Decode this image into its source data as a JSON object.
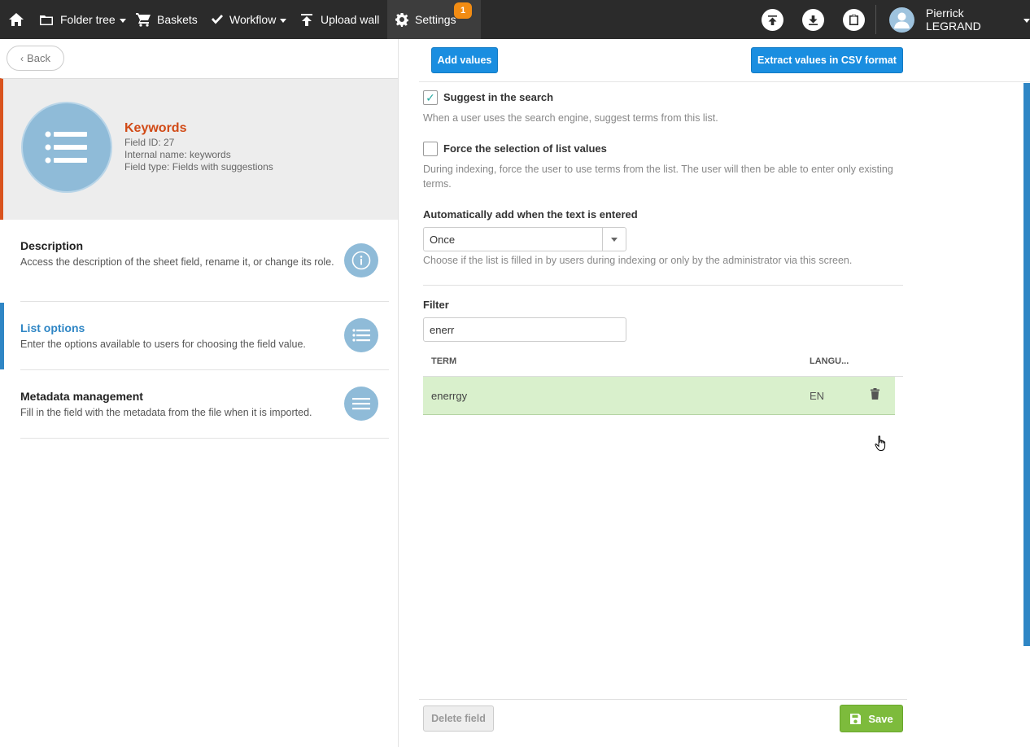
{
  "nav": {
    "folder_tree": "Folder tree",
    "baskets": "Baskets",
    "workflow": "Workflow",
    "upload_wall": "Upload wall",
    "settings": "Settings",
    "settings_badge": "1",
    "user_name": "Pierrick LEGRAND"
  },
  "left": {
    "back_label": "Back",
    "field": {
      "title": "Keywords",
      "field_id": "Field ID: 27",
      "internal_name": "Internal name: keywords",
      "field_type": "Field type: Fields with suggestions"
    },
    "menu": [
      {
        "title": "Description",
        "desc": "Access the description of the sheet field, rename it, or change its role.",
        "icon": "info-icon"
      },
      {
        "title": "List options",
        "desc": "Enter the options available to users for choosing the field value.",
        "icon": "list-icon"
      },
      {
        "title": "Metadata management",
        "desc": "Fill in the field with the metadata from the file when it is imported.",
        "icon": "lines-icon"
      }
    ]
  },
  "right": {
    "add_values_label": "Add values",
    "extract_csv_label": "Extract values in CSV format",
    "suggest": {
      "label": "Suggest in the search",
      "checked": true,
      "help": "When a user uses the search engine, suggest terms from this list."
    },
    "force": {
      "label": "Force the selection of list values",
      "checked": false,
      "help": "During indexing, force the user to use terms from the list. The user will then be able to enter only existing terms."
    },
    "auto_add": {
      "label": "Automatically add when the text is entered",
      "selected": "Once",
      "help": "Choose if the list is filled in by users during indexing or only by the administrator via this screen."
    },
    "filter": {
      "label": "Filter",
      "value": "enerr"
    },
    "table": {
      "columns": [
        "TERM",
        "LANGU..."
      ],
      "rows": [
        {
          "term": "enerrgy",
          "lang": "EN"
        }
      ]
    },
    "delete_field_label": "Delete field",
    "save_label": "Save"
  },
  "colors": {
    "topbar": "#2b2b2b",
    "accent_blue": "#1a8ee0",
    "accent_orange": "#d14a16",
    "save_green": "#7dbb3c",
    "row_highlight": "#d9f0cc"
  }
}
